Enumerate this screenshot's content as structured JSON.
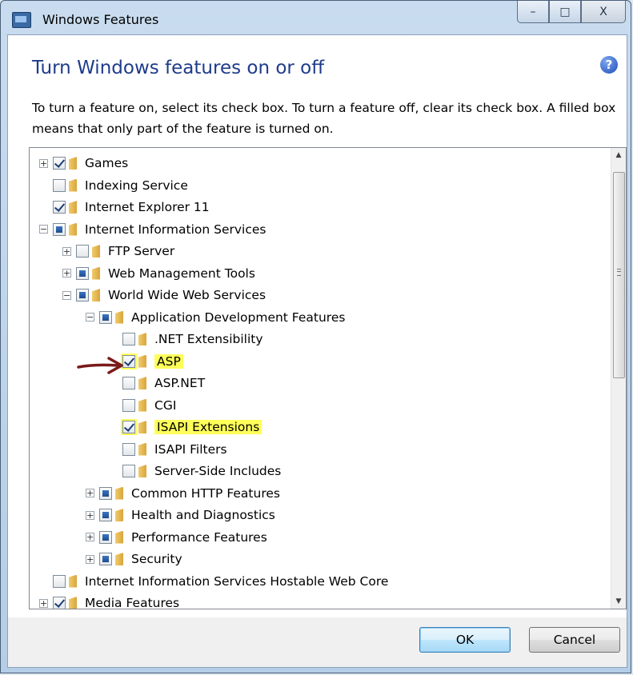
{
  "window": {
    "title": "Windows Features",
    "buttons": {
      "minimize": "–",
      "maximize": "□",
      "close": "X"
    }
  },
  "dialog": {
    "heading": "Turn Windows features on or off",
    "help": "?",
    "description": "To turn a feature on, select its check box. To turn a feature off, clear its check box. A filled box means that only part of the feature is turned on."
  },
  "tree": {
    "items": [
      {
        "label": "Games",
        "level": 0,
        "state": "checked",
        "expander": "+"
      },
      {
        "label": "Indexing Service",
        "level": 0,
        "state": "unchecked",
        "expander": ""
      },
      {
        "label": "Internet Explorer 11",
        "level": 0,
        "state": "checked",
        "expander": ""
      },
      {
        "label": "Internet Information Services",
        "level": 0,
        "state": "partial",
        "expander": "−"
      },
      {
        "label": "FTP Server",
        "level": 1,
        "state": "unchecked",
        "expander": "+"
      },
      {
        "label": "Web Management Tools",
        "level": 1,
        "state": "partial",
        "expander": "+"
      },
      {
        "label": "World Wide Web Services",
        "level": 1,
        "state": "partial",
        "expander": "−"
      },
      {
        "label": "Application Development Features",
        "level": 2,
        "state": "partial",
        "expander": "−"
      },
      {
        "label": ".NET Extensibility",
        "level": 3,
        "state": "unchecked",
        "expander": ""
      },
      {
        "label": "ASP",
        "level": 3,
        "state": "checked",
        "expander": "",
        "highlight": true
      },
      {
        "label": "ASP.NET",
        "level": 3,
        "state": "unchecked",
        "expander": ""
      },
      {
        "label": "CGI",
        "level": 3,
        "state": "unchecked",
        "expander": ""
      },
      {
        "label": "ISAPI Extensions",
        "level": 3,
        "state": "checked",
        "expander": "",
        "highlight": true
      },
      {
        "label": "ISAPI Filters",
        "level": 3,
        "state": "unchecked",
        "expander": ""
      },
      {
        "label": "Server-Side Includes",
        "level": 3,
        "state": "unchecked",
        "expander": ""
      },
      {
        "label": "Common HTTP Features",
        "level": 2,
        "state": "partial",
        "expander": "+"
      },
      {
        "label": "Health and Diagnostics",
        "level": 2,
        "state": "partial",
        "expander": "+"
      },
      {
        "label": "Performance Features",
        "level": 2,
        "state": "partial",
        "expander": "+"
      },
      {
        "label": "Security",
        "level": 2,
        "state": "partial",
        "expander": "+"
      },
      {
        "label": "Internet Information Services Hostable Web Core",
        "level": 0,
        "state": "unchecked",
        "expander": ""
      },
      {
        "label": "Media Features",
        "level": 0,
        "state": "checked",
        "expander": "+"
      }
    ]
  },
  "buttons": {
    "ok": "OK",
    "cancel": "Cancel"
  },
  "colors": {
    "highlight": "#ffff5a",
    "heading": "#1e3b8c",
    "arrow": "#7a1a1a"
  }
}
